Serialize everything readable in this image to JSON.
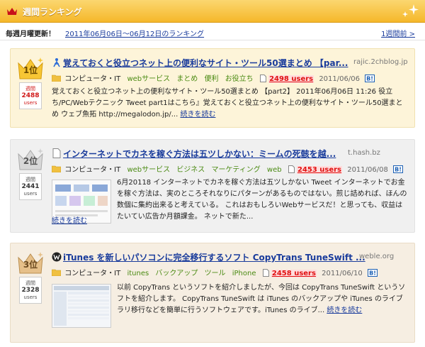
{
  "header": {
    "title": "週間ランキング"
  },
  "subbar": {
    "weekly_label": "毎週月曜更新！",
    "period": "2011年06月06日〜06月12日のランキング",
    "prev_link": "1週間前 >"
  },
  "labels": {
    "weekly": "週間",
    "users": "users",
    "read_more": "続きを読む"
  },
  "entries": [
    {
      "rank": "1位",
      "users_count": "2488",
      "title": "覚えておくと役立つネット上の便利なサイト・ツール50選まとめ 【par...",
      "domain": "rajic.2chblog.jp",
      "category": "コンピュータ・IT",
      "tags": [
        "webサービス",
        "まとめ",
        "便利",
        "お役立ち"
      ],
      "users_link": "2498 users",
      "date": "2011/06/06",
      "description": "覚えておくと役立つネット上の便利なサイト・ツール50選まとめ 【part2】 2011年06月06日 11:26 役立ち/PC/Webテクニック Tweet part1はこちら』覚えておくと役立つネット上の便利なサイト・ツール50選まとめ ウェブ魚拓 http://megalodon.jp/..."
    },
    {
      "rank": "2位",
      "users_count": "2441",
      "title": "インターネットでカネを稼ぐ方法は五ツしかない：ミームの死骸を越...",
      "domain": "t.hash.bz",
      "category": "コンピュータ・IT",
      "tags": [
        "webサービス",
        "ビジネス",
        "マーケティング",
        "web"
      ],
      "users_link": "2453 users",
      "date": "2011/06/08",
      "description": "6月20118 インターネットでカネを稼ぐ方法は五ツしかない Tweet インターネットでお金を稼ぐ方法は、実のところそれなりにパターンがあるものではない。煎じ詰めれば、ほんの数個に集約出来ると考えている。 これはおもしろいWebサービスだ！と思っても、収益はたいてい広告か月額課金。 ネットで新た..."
    },
    {
      "rank": "3位",
      "users_count": "2328",
      "title": "iTunes を新しいパソコンに完全移行するソフト CopyTrans TuneSwift ...",
      "domain": "weble.org",
      "category": "コンピュータ・IT",
      "tags": [
        "itunes",
        "バックアップ",
        "ツール",
        "iPhone"
      ],
      "users_link": "2458 users",
      "date": "2011/06/10",
      "description": "以前 CopyTrans というソフトを紹介しましたが、今回は CopyTrans TuneSwift というソフトを紹介します。 CopyTrans TuneSwift は iTunes のバックアップや iTunes のライブラリ移行などを簡単に行うソフトウェアです。iTunes のライブ..."
    }
  ]
}
